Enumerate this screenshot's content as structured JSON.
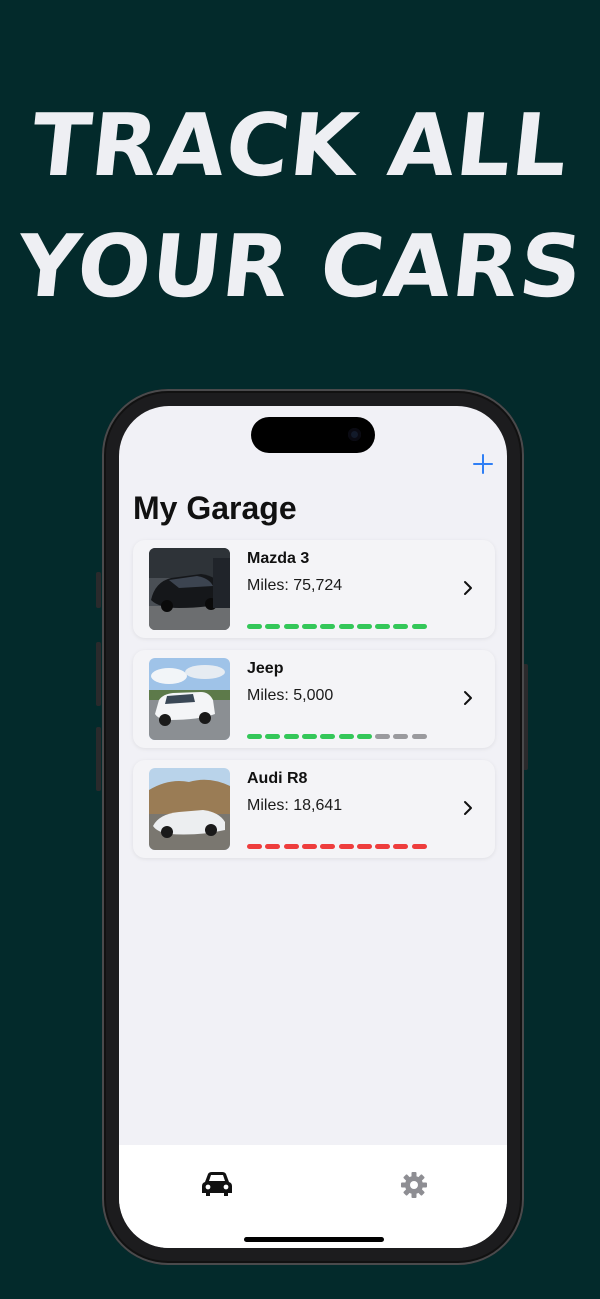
{
  "headline": {
    "line1": "TRACK ALL",
    "line2": "YOUR CARS"
  },
  "app": {
    "title": "My Garage",
    "add_icon": "plus-icon",
    "accent_color": "#2f7ff5",
    "cars": [
      {
        "name": "Mazda 3",
        "miles": "Miles: 75,724",
        "thumbnail": "dark-sedan-photo",
        "progress_filled": 10,
        "progress_total": 10,
        "bar_color": "#34c759"
      },
      {
        "name": "Jeep",
        "miles": "Miles: 5,000",
        "thumbnail": "white-suv-photo",
        "progress_filled": 7,
        "progress_total": 10,
        "bar_color": "#34c759"
      },
      {
        "name": "Audi R8",
        "miles": "Miles: 18,641",
        "thumbnail": "white-sports-car-photo",
        "progress_filled": 10,
        "progress_total": 10,
        "bar_color": "#ee3d3d"
      }
    ],
    "tabs": [
      {
        "icon": "car-icon",
        "selected": true
      },
      {
        "icon": "gear-icon",
        "selected": false
      }
    ]
  }
}
